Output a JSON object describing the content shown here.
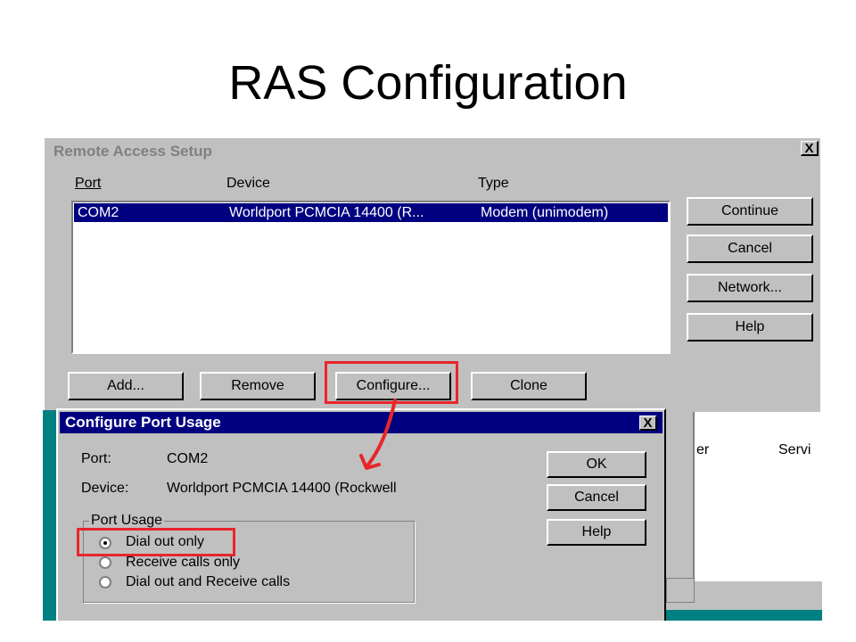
{
  "slide": {
    "title": "RAS Configuration"
  },
  "main_dialog": {
    "title": "Remote Access Setup",
    "close_label": "X",
    "columns": {
      "port": "Port",
      "device": "Device",
      "type": "Type"
    },
    "rows": [
      {
        "port": "COM2",
        "device": "Worldport PCMCIA 14400 (R...",
        "type": "Modem (unimodem)"
      }
    ],
    "buttons": {
      "continue": "Continue",
      "cancel": "Cancel",
      "network": "Network...",
      "help": "Help",
      "add": "Add...",
      "remove": "Remove",
      "configure": "Configure...",
      "clone": "Clone"
    }
  },
  "background_window": {
    "text_left": "er",
    "text_right": "Servi"
  },
  "port_dialog": {
    "title": "Configure Port Usage",
    "close_label": "X",
    "port_label": "Port:",
    "port_value": "COM2",
    "device_label": "Device:",
    "device_value": "Worldport PCMCIA 14400 (Rockwell",
    "group_label": "Port Usage",
    "options": [
      {
        "label": "Dial out only",
        "selected": true
      },
      {
        "label": "Receive calls only",
        "selected": false
      },
      {
        "label": "Dial out and Receive calls",
        "selected": false
      }
    ],
    "buttons": {
      "ok": "OK",
      "cancel": "Cancel",
      "help": "Help"
    }
  },
  "annotation_color": "#e8262b"
}
